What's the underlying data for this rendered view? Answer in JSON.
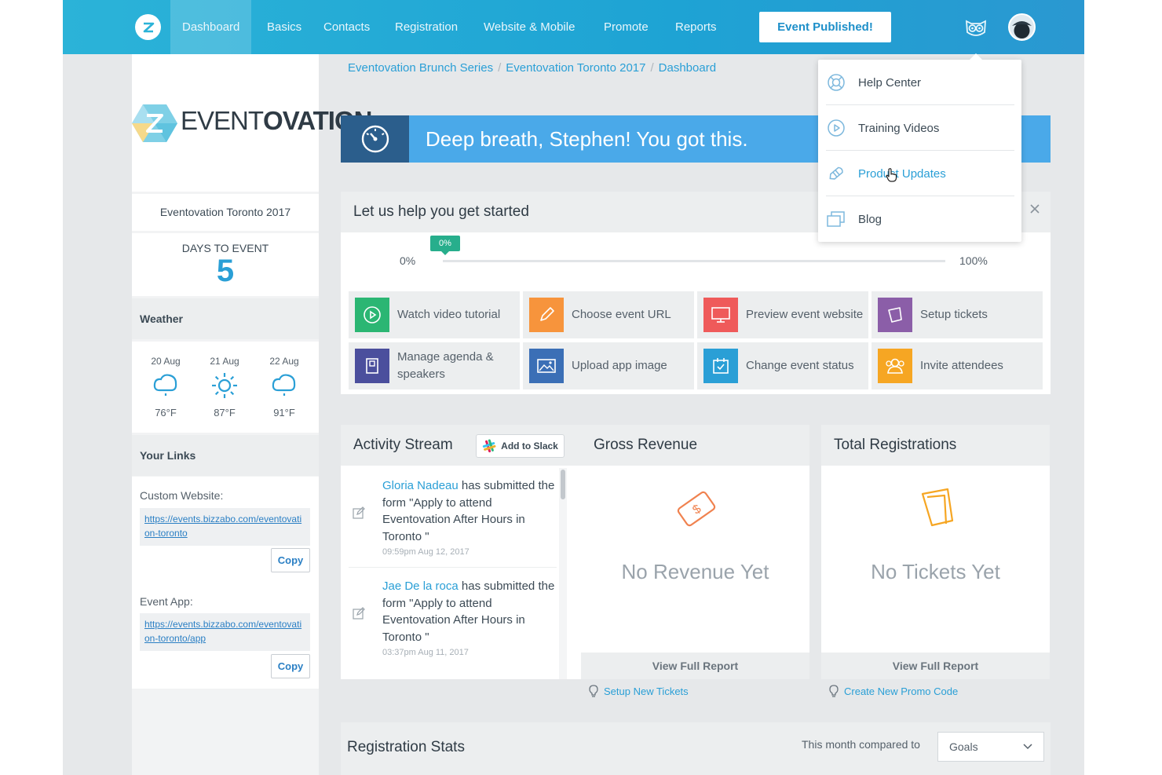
{
  "nav": {
    "items": [
      "Dashboard",
      "Basics",
      "Contacts",
      "Registration",
      "Website & Mobile",
      "Promote",
      "Reports"
    ],
    "publish_label": "Event Published!"
  },
  "brand": {
    "word_light": "EVENT",
    "word_bold": "OVATION"
  },
  "sidebar": {
    "event_name": "Eventovation Toronto 2017",
    "days_label": "DAYS TO EVENT",
    "days_value": "5",
    "weather_title": "Weather",
    "weather": [
      {
        "date": "20 Aug",
        "icon": "cloud-rain-icon",
        "temp": "76°F"
      },
      {
        "date": "21 Aug",
        "icon": "sun-icon",
        "temp": "87°F"
      },
      {
        "date": "22 Aug",
        "icon": "cloud-rain-icon",
        "temp": "91°F"
      }
    ],
    "links_title": "Your Links",
    "custom_label": "Custom Website:",
    "custom_url": "https://events.bizzabo.com/eventovation-toronto",
    "app_label": "Event App:",
    "app_url": "https://events.bizzabo.com/eventovation-toronto/app",
    "copy_label": "Copy"
  },
  "breadcrumb": [
    "Eventovation Brunch Series",
    "Eventovation Toronto 2017",
    "Dashboard"
  ],
  "banner": {
    "message": "Deep breath, Stephen! You got this."
  },
  "get_started": {
    "title": "Let us help you get started",
    "progress": 0,
    "progress_badge": "0%",
    "min_label": "0%",
    "max_label": "100%",
    "tasks": [
      {
        "label": "Watch video tutorial",
        "color": "#2bb673",
        "icon": "play-icon"
      },
      {
        "label": "Choose event URL",
        "color": "#f7943c",
        "icon": "pencil-icon"
      },
      {
        "label": "Preview event website",
        "color": "#ef5a5a",
        "icon": "monitor-icon"
      },
      {
        "label": "Setup tickets",
        "color": "#8b5ea8",
        "icon": "ticket-icon"
      },
      {
        "label": "Manage agenda & speakers",
        "color": "#4b4f9d",
        "icon": "agenda-icon"
      },
      {
        "label": "Upload app image",
        "color": "#3b6fb6",
        "icon": "image-icon"
      },
      {
        "label": "Change event status",
        "color": "#2a9fd6",
        "icon": "calendar-check-icon"
      },
      {
        "label": "Invite attendees",
        "color": "#f6a623",
        "icon": "users-icon"
      }
    ]
  },
  "activity": {
    "title": "Activity Stream",
    "slack_label": "Add to Slack",
    "items": [
      {
        "who": "Gloria Nadeau",
        "text": " has submitted the form \"Apply to attend Eventovation After Hours in Toronto \"",
        "time": "09:59pm Aug 12, 2017"
      },
      {
        "who": "Jae De la roca",
        "text": " has submitted the form \"Apply to attend Eventovation After Hours in Toronto \"",
        "time": "03:37pm Aug 11, 2017"
      }
    ]
  },
  "revenue": {
    "title": "Gross Revenue",
    "empty": "No Revenue Yet",
    "footer": "View Full Report",
    "tip": "Setup New Tickets"
  },
  "registrations": {
    "title": "Total Registrations",
    "empty": "No Tickets Yet",
    "footer": "View Full Report",
    "tip": "Create New Promo Code"
  },
  "reg_stats": {
    "title": "Registration Stats",
    "compare_label": "This month compared to",
    "select_value": "Goals"
  },
  "help_menu": {
    "items": [
      {
        "label": "Help Center",
        "icon": "lifebuoy-icon"
      },
      {
        "label": "Training Videos",
        "icon": "play-circle-icon"
      },
      {
        "label": "Product Updates",
        "icon": "rocket-icon"
      },
      {
        "label": "Blog",
        "icon": "blog-icon"
      }
    ]
  },
  "colors": {
    "brand": "#1ea3d4",
    "accent": "#2a9fd6",
    "success": "#27ae8c",
    "revenue_icon": "#f0824f",
    "tickets_icon": "#f6a623"
  }
}
